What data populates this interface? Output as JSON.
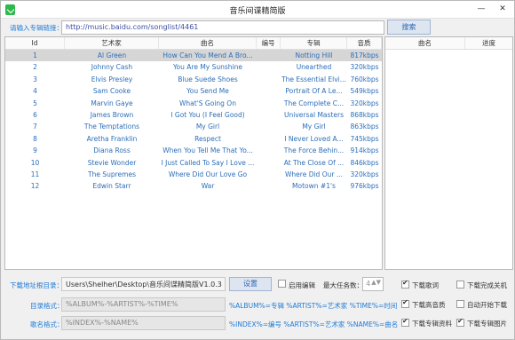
{
  "window": {
    "title": "音乐间谍精简版",
    "minimize": "—",
    "close": "✕"
  },
  "url_bar": {
    "label": "请输入专辑链接：",
    "value": "http://music.baidu.com/songlist/4461",
    "search_label": "搜索"
  },
  "table": {
    "headers": [
      "Id",
      "艺术家",
      "曲名",
      "编号",
      "专辑",
      "音质"
    ],
    "rows": [
      [
        "1",
        "Al Green",
        "How Can You Mend A Bro...",
        "",
        "Notting Hill",
        "817kbps"
      ],
      [
        "2",
        "Johnny Cash",
        "You Are My Sunshine",
        "",
        "Unearthed",
        "320kbps"
      ],
      [
        "3",
        "Elvis Presley",
        "Blue Suede Shoes",
        "",
        "The Essential Elvi...",
        "760kbps"
      ],
      [
        "4",
        "Sam Cooke",
        "You Send Me",
        "",
        "Portrait Of A Le...",
        "549kbps"
      ],
      [
        "5",
        "Marvin Gaye",
        "What'S Going On",
        "",
        "The Complete C...",
        "320kbps"
      ],
      [
        "6",
        "James Brown",
        "I Got You (I Feel Good)",
        "",
        "Universal Masters",
        "868kbps"
      ],
      [
        "7",
        "The Temptations",
        "My Girl",
        "",
        "My Girl",
        "863kbps"
      ],
      [
        "8",
        "Aretha Franklin",
        "Respect",
        "",
        "I Never Loved A...",
        "745kbps"
      ],
      [
        "9",
        "Diana Ross",
        "When You Tell Me That Yo...",
        "",
        "The Force Behin...",
        "914kbps"
      ],
      [
        "10",
        "Stevie Wonder",
        "I Just Called To Say I Love ...",
        "",
        "At The Close Of ...",
        "846kbps"
      ],
      [
        "11",
        "The Supremes",
        "Where Did Our Love Go",
        "",
        "Where Did Our ...",
        "320kbps"
      ],
      [
        "12",
        "Edwin Starr",
        "War",
        "",
        "Motown #1's",
        "976kbps"
      ]
    ]
  },
  "download_panel": {
    "headers": [
      "曲名",
      "进度"
    ]
  },
  "settings": {
    "download_dir_label": "下载地址根目录：",
    "download_dir_value": "Users\\Shelher\\Desktop\\音乐间谍精简版V1.0.3",
    "set_button": "设置",
    "enable_edit_label": "启用编辑",
    "max_tasks_label": "最大任务数：",
    "max_tasks_value": "4",
    "dir_format_label": "目录格式：",
    "dir_format_value": "%ALBUM%-%ARTIST%-%TIME%",
    "dir_hint": "%ALBUM%=专辑 %ARTIST%=艺术家 %TIME%=时间",
    "name_format_label": "歌名格式：",
    "name_format_value": "%INDEX%-%NAME%",
    "name_hint": "%INDEX%=编号 %ARTIST%=艺术家 %NAME%=曲名"
  },
  "options": [
    {
      "label": "下载歌词",
      "checked": true
    },
    {
      "label": "下载完成关机",
      "checked": false
    },
    {
      "label": "下载高音质",
      "checked": true
    },
    {
      "label": "自动开始下载",
      "checked": false
    },
    {
      "label": "下载专辑资料",
      "checked": true
    },
    {
      "label": "下载专辑图片",
      "checked": true
    }
  ]
}
